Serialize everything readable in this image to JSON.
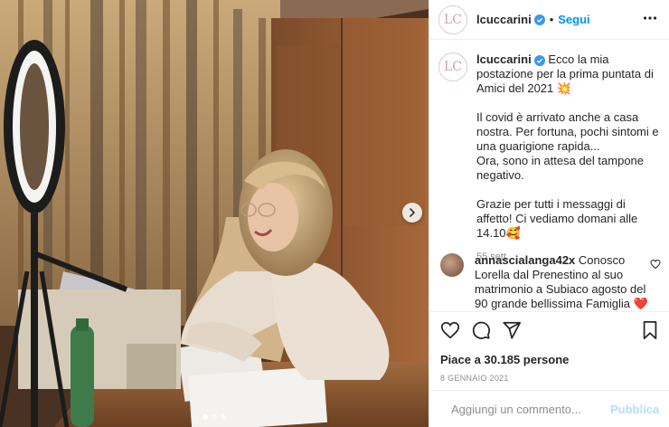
{
  "post": {
    "username": "lcuccarini",
    "avatar_initials": "LC",
    "follow_label": "Segui",
    "separator": "•",
    "caption": "Ecco la mia postazione per la prima puntata di Amici del 2021 💥\n\nIl covid è arrivato anche a casa nostra. Per fortuna, pochi sintomi e una guarigione rapida...\nOra, sono in attesa del tampone negativo.\n\nGrazie per tutti i messaggi di affetto! Ci vediamo domani alle 14.10🥰",
    "caption_time": "55 sett.",
    "likes": "Piace a 30.185 persone",
    "date": "8 GENNAIO 2021"
  },
  "comment": {
    "username": "annascialanga42x",
    "text": "Conosco Lorella dal Prenestino al suo matrimonio a Subiaco agosto del 90 grande bellissima Famiglia ❤️"
  },
  "composer": {
    "placeholder": "Aggiungi un commento...",
    "publish_label": "Pubblica"
  },
  "carousel": {
    "count": 3,
    "active": 0
  },
  "colors": {
    "accent": "#0095f6",
    "verified": "#3897f0",
    "publish_disabled": "#b2dffc"
  },
  "icons": [
    "emoji-icon",
    "heart-icon",
    "comment-icon",
    "share-icon",
    "save-icon",
    "more-icon",
    "chevron-right-icon",
    "verified-icon"
  ]
}
